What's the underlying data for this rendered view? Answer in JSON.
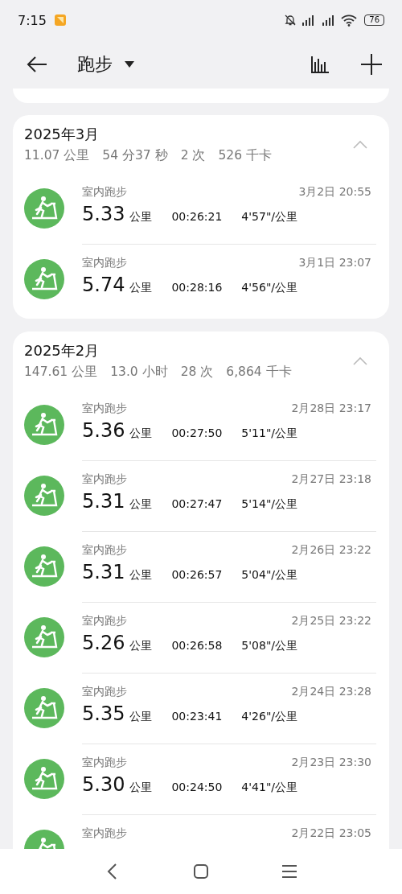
{
  "status_bar": {
    "time": "7:15",
    "battery": "76"
  },
  "header": {
    "title": "跑步"
  },
  "months": [
    {
      "title": "2025年3月",
      "expanded": true,
      "summary": [
        "11.07 公里",
        "54 分37 秒",
        "2 次",
        "526 千卡"
      ],
      "records": [
        {
          "type": "室内跑步",
          "date": "3月2日 20:55",
          "distance": "5.33",
          "unit": "公里",
          "duration": "00:26:21",
          "pace": "4'57\"/公里"
        },
        {
          "type": "室内跑步",
          "date": "3月1日 23:07",
          "distance": "5.74",
          "unit": "公里",
          "duration": "00:28:16",
          "pace": "4'56\"/公里"
        }
      ]
    },
    {
      "title": "2025年2月",
      "expanded": true,
      "summary": [
        "147.61 公里",
        "13.0 小时",
        "28 次",
        "6,864 千卡"
      ],
      "records": [
        {
          "type": "室内跑步",
          "date": "2月28日 23:17",
          "distance": "5.36",
          "unit": "公里",
          "duration": "00:27:50",
          "pace": "5'11\"/公里"
        },
        {
          "type": "室内跑步",
          "date": "2月27日 23:18",
          "distance": "5.31",
          "unit": "公里",
          "duration": "00:27:47",
          "pace": "5'14\"/公里"
        },
        {
          "type": "室内跑步",
          "date": "2月26日 23:22",
          "distance": "5.31",
          "unit": "公里",
          "duration": "00:26:57",
          "pace": "5'04\"/公里"
        },
        {
          "type": "室内跑步",
          "date": "2月25日 23:22",
          "distance": "5.26",
          "unit": "公里",
          "duration": "00:26:58",
          "pace": "5'08\"/公里"
        },
        {
          "type": "室内跑步",
          "date": "2月24日 23:28",
          "distance": "5.35",
          "unit": "公里",
          "duration": "00:23:41",
          "pace": "4'26\"/公里"
        },
        {
          "type": "室内跑步",
          "date": "2月23日 23:30",
          "distance": "5.30",
          "unit": "公里",
          "duration": "00:24:50",
          "pace": "4'41\"/公里"
        },
        {
          "type": "室内跑步",
          "date": "2月22日 23:05"
        }
      ]
    }
  ]
}
